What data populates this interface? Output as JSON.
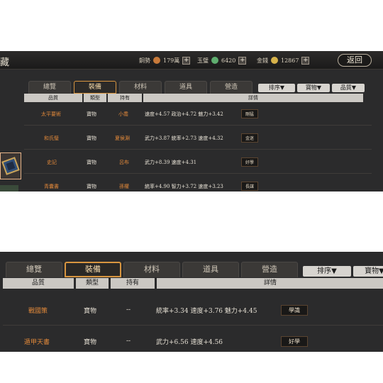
{
  "top": {
    "title": "藏",
    "currencies": [
      {
        "label": "銅勢",
        "value": "179萬",
        "icon": "copper-coin-icon",
        "color": "#c87a3a"
      },
      {
        "label": "玉璧",
        "value": "6420",
        "icon": "jade-icon",
        "color": "#5fae6f"
      },
      {
        "label": "金錢",
        "value": "12867",
        "icon": "gold-coin-icon",
        "color": "#d6b24a"
      }
    ],
    "plus": "+",
    "back_label": "返回",
    "tabs": [
      "總覽",
      "裝備",
      "材料",
      "道具",
      "營造"
    ],
    "sort_buttons": [
      "排序▼",
      "寶物▼",
      "品質▼"
    ],
    "headers": [
      "品質",
      "類型",
      "持有",
      "詳情"
    ],
    "rows": [
      {
        "name": "太平要術",
        "type": "寶物",
        "owner": "小喬",
        "detail": "速度+4.57 政治+4.72 魅力+3.42",
        "badge": "剛猛"
      },
      {
        "name": "和氏璧",
        "type": "寶物",
        "owner": "夏侯淵",
        "detail": "武力+3.87 統率+2.73 速度+4.32",
        "badge": "金迷"
      },
      {
        "name": "史記",
        "type": "寶物",
        "owner": "呂布",
        "detail": "武力+8.39 速度+4.31",
        "badge": "好學"
      },
      {
        "name": "青囊書",
        "type": "寶物",
        "owner": "孫權",
        "detail": "統率+4.90 智力+3.72 速度+3.23",
        "badge": "長謀"
      }
    ]
  },
  "bottom": {
    "tabs": [
      "總覽",
      "裝備",
      "材料",
      "道具",
      "營造"
    ],
    "sort_buttons": [
      "排序▼",
      "寶物▼"
    ],
    "headers": [
      "品質",
      "類型",
      "持有",
      "詳情"
    ],
    "rows": [
      {
        "name": "戰國策",
        "type": "寶物",
        "owner": "--",
        "detail": "統率+3.34 速度+3.76 魅力+4.45",
        "badge": "學識"
      },
      {
        "name": "遁甲天書",
        "type": "寶物",
        "owner": "--",
        "detail": "武力+6.56 速度+4.56",
        "badge": "好學"
      }
    ]
  },
  "colors": {
    "accent": "#d89540",
    "name_orange": "#e0883a",
    "panel_bg": "#2b2b2c"
  }
}
